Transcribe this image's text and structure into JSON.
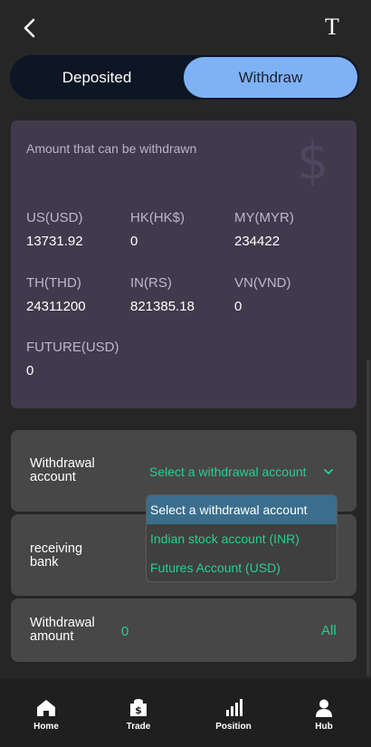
{
  "header": {
    "back_icon": "chevron-left-icon",
    "font_icon": "text-size-icon"
  },
  "tabs": [
    {
      "label": "Deposited",
      "active": false
    },
    {
      "label": "Withdraw",
      "active": true
    }
  ],
  "balance_card": {
    "title": "Amount that can be withdrawn",
    "icon": "dollar-icon",
    "currencies": [
      {
        "code": "US(USD)",
        "value": "13731.92"
      },
      {
        "code": "HK(HK$)",
        "value": "0"
      },
      {
        "code": "MY(MYR)",
        "value": "234422"
      },
      {
        "code": "TH(THD)",
        "value": "24311200"
      },
      {
        "code": "IN(RS)",
        "value": "821385.18"
      },
      {
        "code": "VN(VND)",
        "value": "0"
      },
      {
        "code": "FUTURE(USD)",
        "value": "0"
      }
    ]
  },
  "withdrawal_account": {
    "label": "Withdrawal account",
    "selected": "Select a withdrawal account",
    "options": [
      "Select a withdrawal account",
      "Indian stock account (INR)",
      "Futures Account (USD)"
    ]
  },
  "receiving_bank": {
    "label": "receiving bank"
  },
  "withdrawal_amount": {
    "label": "Withdrawal amount",
    "value": "0",
    "all_label": "All"
  },
  "nav": [
    {
      "label": "Home",
      "icon": "home-icon"
    },
    {
      "label": "Trade",
      "icon": "trade-bag-icon"
    },
    {
      "label": "Position",
      "icon": "bar-chart-icon"
    },
    {
      "label": "Hub",
      "icon": "user-icon"
    }
  ],
  "colors": {
    "accent_green": "#25d08f",
    "tab_active": "#7fb2f5",
    "card_bg": "#413a4c"
  }
}
